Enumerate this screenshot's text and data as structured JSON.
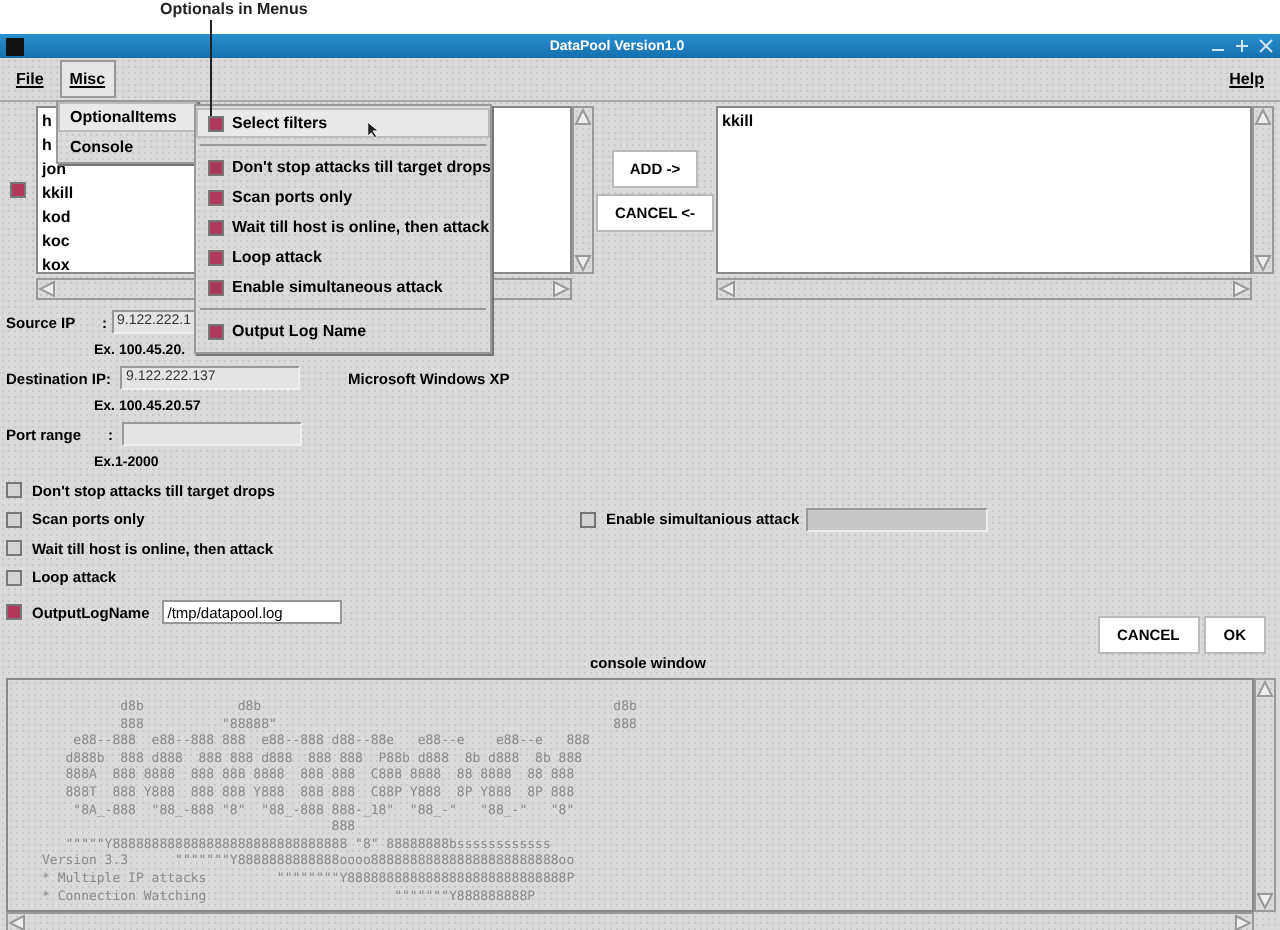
{
  "annotation": {
    "label": "Optionals in Menus"
  },
  "window": {
    "title": "DataPool Version1.0"
  },
  "menubar": [
    {
      "label": "File",
      "selected": false
    },
    {
      "label": "Misc",
      "selected": true
    },
    {
      "label": "Help",
      "selected": false
    }
  ],
  "misc_menu": {
    "items": [
      {
        "label": "OptionalItems",
        "selected": true
      },
      {
        "label": "Console",
        "selected": false
      }
    ],
    "submenu": [
      {
        "kind": "check",
        "label": "Select filters",
        "checked": true,
        "selected": true
      },
      {
        "kind": "separator"
      },
      {
        "kind": "check",
        "label": "Don't stop attacks till target drops",
        "checked": true,
        "selected": false
      },
      {
        "kind": "check",
        "label": "Scan ports only",
        "checked": true,
        "selected": false
      },
      {
        "kind": "check",
        "label": "Wait till host is online, then attack",
        "checked": true,
        "selected": false
      },
      {
        "kind": "check",
        "label": "Loop attack",
        "checked": true,
        "selected": false
      },
      {
        "kind": "check",
        "label": "Enable simultaneous attack",
        "checked": true,
        "selected": false
      },
      {
        "kind": "separator"
      },
      {
        "kind": "check",
        "label": "Output Log Name",
        "checked": true,
        "selected": false
      }
    ]
  },
  "host_list": {
    "checked": true,
    "items": [
      "h",
      "h",
      "jon",
      "kkill",
      "kod",
      "koc",
      "kox"
    ]
  },
  "transfer_buttons": [
    "ADD ->",
    "CANCEL <-"
  ],
  "target_list": {
    "items": [
      "kkill"
    ]
  },
  "form": {
    "source_ip": {
      "label": "Source IP",
      "colon": ":",
      "value": "9.122.222.1",
      "example": "Ex. 100.45.20."
    },
    "destination_ip": {
      "label": "Destination IP:",
      "value": "9.122.222.137",
      "example": "Ex. 100.45.20.57",
      "os": "Microsoft Windows XP"
    },
    "port_range": {
      "label": "Port range",
      "colon": ":",
      "example": "Ex.1-2000"
    }
  },
  "options": [
    {
      "label": "Don't stop attacks till target drops",
      "checked": false
    },
    {
      "label": "Scan ports only",
      "checked": false
    },
    {
      "label": "Wait till host is online, then attack",
      "checked": false
    },
    {
      "label": "Loop attack",
      "checked": false
    }
  ],
  "simultaneous": {
    "label": "Enable simultanious attack",
    "checked": false
  },
  "output_log": {
    "label": "OutputLogName",
    "checked": true,
    "value": "/tmp/datapool.log"
  },
  "dialog_buttons": [
    "CANCEL",
    "OK"
  ],
  "console": {
    "title": "console window",
    "lines": [
      "          d8b            d8b                                             d8b",
      "          888          \"88888\"                                           888",
      "    e88--888  e88--888 888  e88--888 d88--88e   e88--e    e88--e   888",
      "   d888b  888 d888  888 888 d888  888 888  P88b d888  8b d888  8b 888",
      "   888A  888 8888  888 888 8888  888 888  C888 8888  88 8888  88 888",
      "   888T  888 Y888  888 888 Y888  888 888  C88P Y888  8P Y888  8P 888",
      "    \"8A_-888  \"88_-888 \"8\"  \"88_-888 888-_18\"  \"88_-\"   \"88_-\"   \"8\"",
      "                                     888",
      "   \"\"\"\"\"Y888888888888888888888888888888 \"8\" 88888888bssssssssssss",
      "Version 3.3      \"\"\"\"\"\"\"Y8888888888888oooo888888888888888888888888oo",
      "* Multiple IP attacks         \"\"\"\"\"\"\"\"Y8888888888888888888888888888P",
      "* Connection Watching                        \"\"\"\"\"\"\"Y888888888P"
    ]
  }
}
